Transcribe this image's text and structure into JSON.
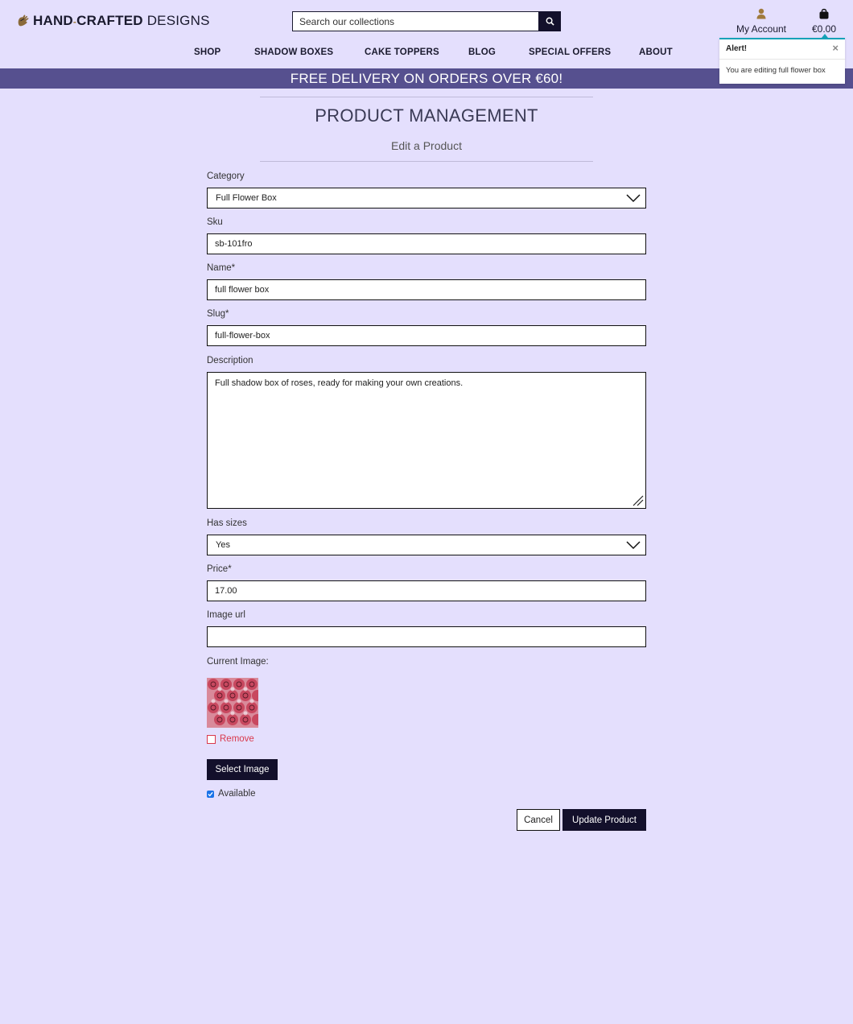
{
  "brand": {
    "part1": "HAND",
    "part2": "CRAFTED",
    "part3": "DESIGNS"
  },
  "search": {
    "placeholder": "Search our collections"
  },
  "account": {
    "label": "My Account"
  },
  "cart": {
    "total": "€0.00"
  },
  "nav": [
    "SHOP",
    "SHADOW BOXES",
    "CAKE TOPPERS",
    "BLOG",
    "SPECIAL OFFERS",
    "ABOUT"
  ],
  "banner": "FREE DELIVERY ON ORDERS OVER €60!",
  "toast": {
    "title": "Alert!",
    "close": "×",
    "message": "You are editing full flower box"
  },
  "page": {
    "title": "PRODUCT MANAGEMENT",
    "subtitle": "Edit a Product"
  },
  "form": {
    "category_label": "Category",
    "category_value": "Full Flower Box",
    "sku_label": "Sku",
    "sku_value": "sb-101fro",
    "name_label": "Name*",
    "name_value": "full flower box",
    "slug_label": "Slug*",
    "slug_value": "full-flower-box",
    "description_label": "Description",
    "description_value": "Full shadow box of roses, ready for making your own creations.",
    "has_sizes_label": "Has sizes",
    "has_sizes_value": "Yes",
    "price_label": "Price*",
    "price_value": "17.00",
    "image_url_label": "Image url",
    "image_url_value": "",
    "current_image_label": "Current Image:",
    "remove_label": "Remove",
    "select_image_label": "Select Image",
    "available_label": "Available",
    "cancel_label": "Cancel",
    "update_label": "Update Product"
  },
  "colors": {
    "background": "#e4dffd",
    "banner": "#56508f",
    "dark_button": "#13102b",
    "remove_red": "#d9394c",
    "toast_accent": "#17a2b8"
  }
}
